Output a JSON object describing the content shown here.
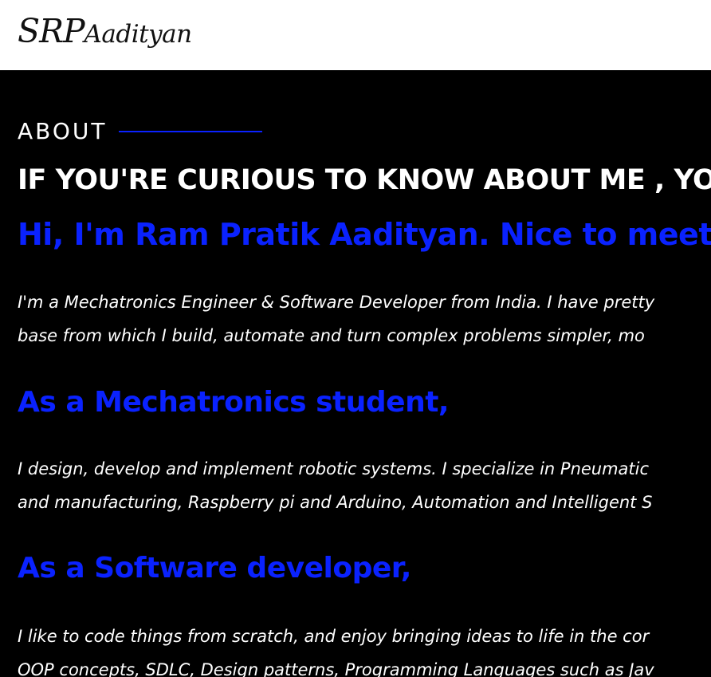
{
  "header": {
    "logo_main": "SRP",
    "logo_sub": "Aadityan"
  },
  "about": {
    "label": "ABOUT",
    "headline": "IF YOU'RE CURIOUS TO KNOW ABOUT ME , YO",
    "greeting": "Hi, I'm Ram Pratik Aadityan. Nice to meet",
    "intro_lines": [
      "I'm a Mechatronics Engineer & Software Developer from India. I have pretty",
      "base from which I build, automate and turn complex problems simpler, mo"
    ],
    "mechatronics": {
      "heading": "As a Mechatronics student,",
      "lines": [
        "I design, develop and implement robotic systems. I specialize in Pneumatic",
        "and manufacturing, Raspberry pi and Arduino, Automation and Intelligent S"
      ]
    },
    "software": {
      "heading": "As a Software developer,",
      "lines": [
        "I like to code things from scratch, and enjoy bringing ideas to life in the cor",
        "OOP concepts, SDLC, Design patterns, Programming Languages such as Jav"
      ]
    }
  },
  "colors": {
    "accent_blue": "#0a22ff",
    "background": "#000000",
    "header_bg": "#ffffff",
    "text": "#ffffff"
  }
}
